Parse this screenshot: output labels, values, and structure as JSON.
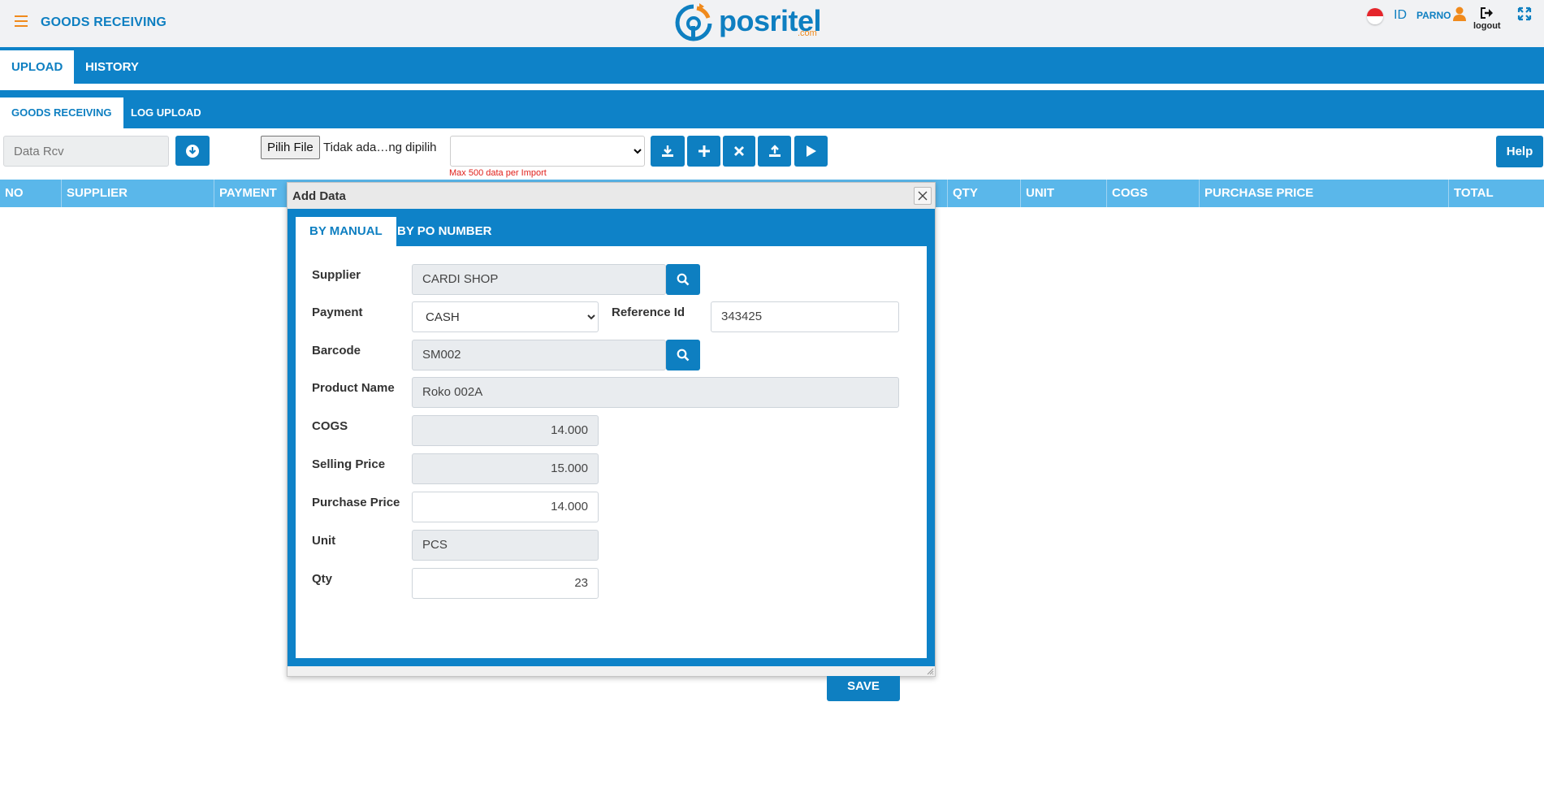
{
  "header": {
    "menu_icon": "hamburger-icon",
    "title": "GOODS RECEIVING",
    "logo_text": "posritel",
    "logo_sub": ".com",
    "language": "ID",
    "user": "PARNO",
    "logout_label": "logout"
  },
  "main_tabs": [
    {
      "label": "UPLOAD",
      "active": true
    },
    {
      "label": "HISTORY",
      "active": false
    }
  ],
  "sub_tabs": [
    {
      "label": "GOODS RECEIVING",
      "active": true
    },
    {
      "label": "LOG UPLOAD",
      "active": false
    }
  ],
  "toolbar": {
    "data_rcv_placeholder": "Data Rcv",
    "file_button": "Pilih File",
    "file_status": "Tidak ada…ng dipilih",
    "max_note": "Max 500 data per Import",
    "help_label": "Help",
    "icons": [
      "download-icon",
      "plus-icon",
      "times-icon",
      "upload-icon",
      "play-icon"
    ]
  },
  "table": {
    "columns": [
      "NO",
      "SUPPLIER",
      "PAYMENT",
      "QTY",
      "UNIT",
      "COGS",
      "PURCHASE PRICE",
      "TOTAL"
    ]
  },
  "dialog": {
    "title": "Add Data",
    "tabs": [
      {
        "label": "BY MANUAL",
        "active": true
      },
      {
        "label": "BY PO NUMBER",
        "active": false
      }
    ],
    "fields": {
      "supplier": {
        "label": "Supplier",
        "value": "CARDI  SHOP"
      },
      "payment": {
        "label": "Payment",
        "value": "CASH"
      },
      "reference_id": {
        "label": "Reference Id",
        "value": "343425"
      },
      "barcode": {
        "label": "Barcode",
        "value": "SM002"
      },
      "product_name": {
        "label": "Product Name",
        "value": "Roko 002A"
      },
      "cogs": {
        "label": "COGS",
        "value": "14.000"
      },
      "selling_price": {
        "label": "Selling Price",
        "value": "15.000"
      },
      "purchase_price": {
        "label": "Purchase Price",
        "value": "14.000"
      },
      "unit": {
        "label": "Unit",
        "value": "PCS"
      },
      "qty": {
        "label": "Qty",
        "value": "23"
      }
    },
    "save_label": "SAVE"
  },
  "colors": {
    "primary": "#0e82c8",
    "header_light": "#5ab7ea",
    "accent": "#f08a1c",
    "warning_text": "#e0201b"
  }
}
